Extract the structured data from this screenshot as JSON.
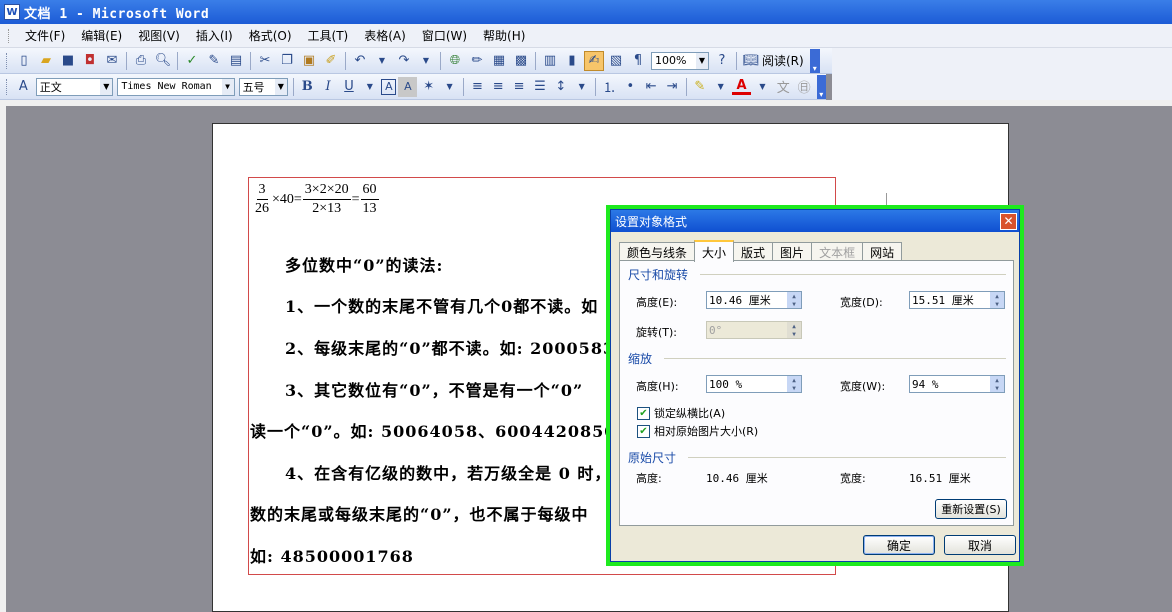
{
  "window": {
    "title": "文档 1 - Microsoft Word"
  },
  "menu": [
    "文件(F)",
    "编辑(E)",
    "视图(V)",
    "插入(I)",
    "格式(O)",
    "工具(T)",
    "表格(A)",
    "窗口(W)",
    "帮助(H)"
  ],
  "standard_toolbar": {
    "icons": [
      "new-icon",
      "open-icon",
      "save-icon",
      "permission-icon",
      "print-preview-icon",
      "print-icon",
      "spelling-icon",
      "research-icon",
      "cut-icon",
      "copy-icon",
      "paste-icon",
      "format-painter-icon",
      "undo-icon",
      "redo-icon",
      "hyperlink-icon",
      "tables-borders-icon",
      "insert-table-icon",
      "insert-excel-icon",
      "columns-icon",
      "drawing-icon",
      "document-map-icon",
      "show-hide-icon"
    ],
    "zoom": "100%",
    "read_label": "阅读(R)"
  },
  "formatting_toolbar": {
    "style": "正文",
    "font": "Times New Roman",
    "size": "五号",
    "bold": "B",
    "italic": "I",
    "underline": "U"
  },
  "document": {
    "formula": {
      "frac1_num": "3",
      "frac1_den": "26",
      "times40": "×40=",
      "frac2_num": "3×2×20",
      "frac2_den": "2×13",
      "eq": "=",
      "frac3_num": "60",
      "frac3_den": "13"
    },
    "lines": [
      "多位数中“0”的读法:",
      "1、一个数的末尾不管有几个0都不读。如",
      "2、每级末尾的“0”都不读。如: 2000583",
      "3、其它数位有“0”，不管是有一个“0”",
      "读一个“0”。如: 50064058、600442085009",
      "4、在含有亿级的数中，若万级全是 0 时，",
      "数的末尾或每级末尾的“0”，也不属于每级中",
      "如: 48500001768"
    ]
  },
  "dialog": {
    "title": "设置对象格式",
    "tabs": [
      "颜色与线条",
      "大小",
      "版式",
      "图片",
      "文本框",
      "网站"
    ],
    "active_tab": "大小",
    "size_rotate_label": "尺寸和旋转",
    "height_label": "高度(E):",
    "height_value": "10.46 厘米",
    "width_label": "宽度(D):",
    "width_value": "15.51 厘米",
    "rotate_label": "旋转(T):",
    "rotate_value": "0°",
    "scale_label": "缩放",
    "scale_height_label": "高度(H):",
    "scale_height_value": "100 %",
    "scale_width_label": "宽度(W):",
    "scale_width_value": "94 %",
    "lock_aspect_label": "锁定纵横比(A)",
    "relative_label": "相对原始图片大小(R)",
    "original_label": "原始尺寸",
    "orig_height_label": "高度:",
    "orig_height_value": "10.46 厘米",
    "orig_width_label": "宽度:",
    "orig_width_value": "16.51 厘米",
    "reset_label": "重新设置(S)",
    "ok_label": "确定",
    "cancel_label": "取消"
  }
}
